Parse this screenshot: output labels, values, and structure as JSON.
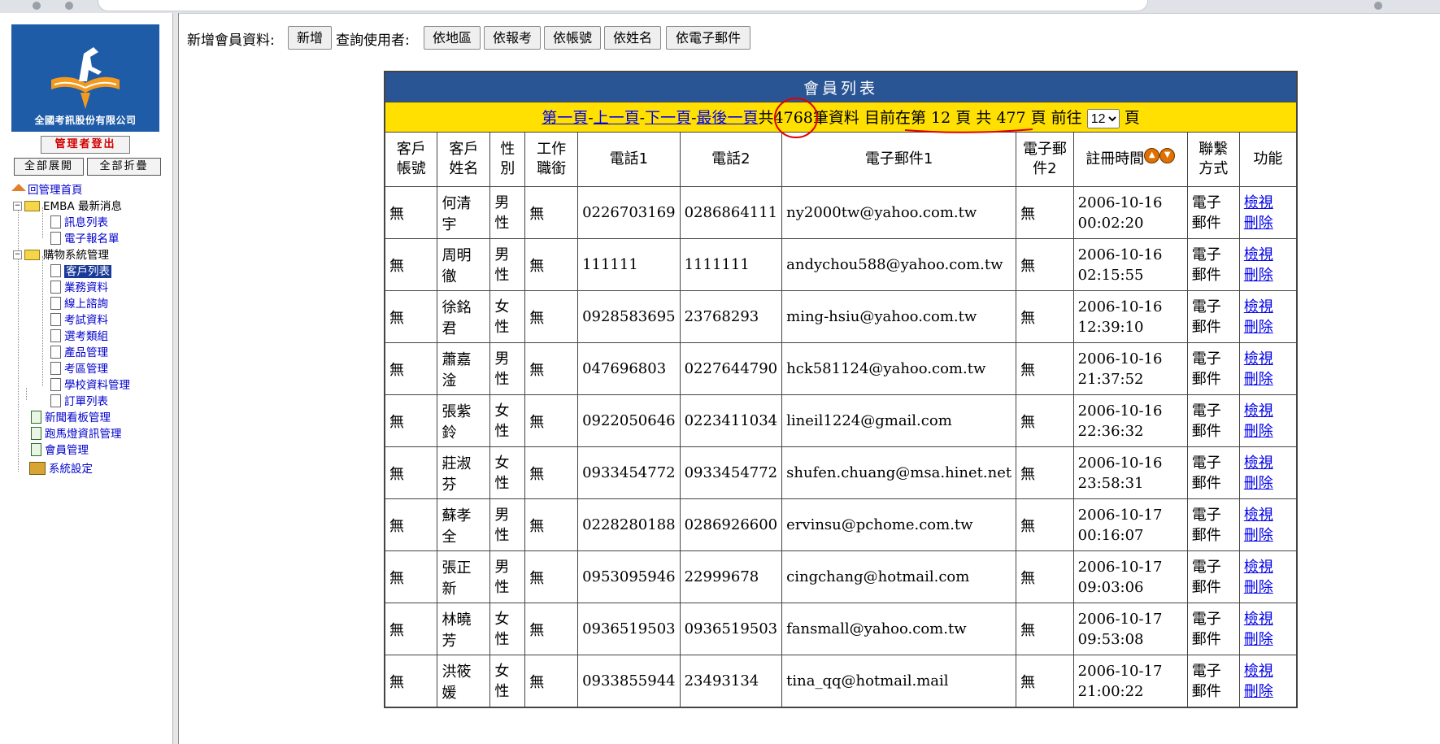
{
  "sidebar": {
    "logo_text": "全國考訊股份有限公司",
    "logout_label": "管理者登出",
    "expand_all_label": "全部展開",
    "collapse_all_label": "全部折疊",
    "tree": [
      {
        "label": "回管理首頁",
        "icon": "home-icon"
      },
      {
        "label": "EMBA 最新消息",
        "icon": "folder-icon"
      },
      {
        "label": "訊息列表",
        "icon": "document-icon"
      },
      {
        "label": "電子報名單",
        "icon": "document-icon"
      },
      {
        "label": "購物系統管理",
        "icon": "folder-icon"
      },
      {
        "label": "客戶列表",
        "icon": "document-icon",
        "selected": true
      },
      {
        "label": "業務資料",
        "icon": "document-icon"
      },
      {
        "label": "線上諮詢",
        "icon": "document-icon"
      },
      {
        "label": "考試資料",
        "icon": "document-icon"
      },
      {
        "label": "選考類組",
        "icon": "document-icon"
      },
      {
        "label": "產品管理",
        "icon": "document-icon"
      },
      {
        "label": "考區管理",
        "icon": "document-icon"
      },
      {
        "label": "學校資料管理",
        "icon": "document-icon"
      },
      {
        "label": "訂單列表",
        "icon": "document-icon"
      },
      {
        "label": "新聞看板管理",
        "icon": "document-icon"
      },
      {
        "label": "跑馬燈資訊管理",
        "icon": "document-icon"
      },
      {
        "label": "會員管理",
        "icon": "document-icon"
      },
      {
        "label": "系統設定",
        "icon": "settings-icon"
      }
    ]
  },
  "toolbar": {
    "add_label": "新增會員資料:",
    "add_button": "新增",
    "query_label": "查詢使用者:",
    "buttons": [
      "依地區",
      "依報考",
      "依帳號",
      "依姓名",
      "依電子郵件"
    ]
  },
  "table": {
    "title": "會員列表",
    "pager": {
      "first": "第一頁",
      "prev": "上一頁",
      "next": "下一頁",
      "last": "最後一頁",
      "sep": "-",
      "total_prefix": "共",
      "total_records": "4768",
      "total_suffix": "筆資料 目前在第",
      "current_page": "12",
      "page_of": "頁 共",
      "total_pages": "477",
      "goto_prefix": "頁 前往",
      "goto_value": "12",
      "goto_suffix": "頁"
    },
    "headers": [
      "客戶帳號",
      "客戶姓名",
      "性別",
      "工作職銜",
      "電話1",
      "電話2",
      "電子郵件1",
      "電子郵件2",
      "註冊時間",
      "聯繫方式",
      "功能"
    ],
    "view_label": "檢視",
    "delete_label": "刪除",
    "rows": [
      {
        "account": "無",
        "name": "何清宇",
        "gender": "男性",
        "title": "無",
        "phone1": "0226703169",
        "phone2": "0286864111",
        "email1": "ny2000tw@yahoo.com.tw",
        "email2": "無",
        "date": "2006-10-16",
        "time": "00:02:20",
        "contact": "電子郵件"
      },
      {
        "account": "無",
        "name": "周明徹",
        "gender": "男性",
        "title": "無",
        "phone1": "111111",
        "phone2": "1111111",
        "email1": "andychou588@yahoo.com.tw",
        "email2": "無",
        "date": "2006-10-16",
        "time": "02:15:55",
        "contact": "電子郵件"
      },
      {
        "account": "無",
        "name": "徐銘君",
        "gender": "女性",
        "title": "無",
        "phone1": "0928583695",
        "phone2": "23768293",
        "email1": "ming-hsiu@yahoo.com.tw",
        "email2": "無",
        "date": "2006-10-16",
        "time": "12:39:10",
        "contact": "電子郵件"
      },
      {
        "account": "無",
        "name": "蕭嘉淦",
        "gender": "男性",
        "title": "無",
        "phone1": "047696803",
        "phone2": "0227644790",
        "email1": "hck581124@yahoo.com.tw",
        "email2": "無",
        "date": "2006-10-16",
        "time": "21:37:52",
        "contact": "電子郵件"
      },
      {
        "account": "無",
        "name": "張紫鈴",
        "gender": "女性",
        "title": "無",
        "phone1": "0922050646",
        "phone2": "0223411034",
        "email1": "lineil1224@gmail.com",
        "email2": "無",
        "date": "2006-10-16",
        "time": "22:36:32",
        "contact": "電子郵件"
      },
      {
        "account": "無",
        "name": "莊淑芬",
        "gender": "女性",
        "title": "無",
        "phone1": "0933454772",
        "phone2": "0933454772",
        "email1": "shufen.chuang@msa.hinet.net",
        "email2": "無",
        "date": "2006-10-16",
        "time": "23:58:31",
        "contact": "電子郵件"
      },
      {
        "account": "無",
        "name": "蘇孝全",
        "gender": "男性",
        "title": "無",
        "phone1": "0228280188",
        "phone2": "0286926600",
        "email1": "ervinsu@pchome.com.tw",
        "email2": "無",
        "date": "2006-10-17",
        "time": "00:16:07",
        "contact": "電子郵件"
      },
      {
        "account": "無",
        "name": "張正新",
        "gender": "男性",
        "title": "無",
        "phone1": "0953095946",
        "phone2": "22999678",
        "email1": "cingchang@hotmail.com",
        "email2": "無",
        "date": "2006-10-17",
        "time": "09:03:06",
        "contact": "電子郵件"
      },
      {
        "account": "無",
        "name": "林曉芳",
        "gender": "女性",
        "title": "無",
        "phone1": "0936519503",
        "phone2": "0936519503",
        "email1": "fansmall@yahoo.com.tw",
        "email2": "無",
        "date": "2006-10-17",
        "time": "09:53:08",
        "contact": "電子郵件"
      },
      {
        "account": "無",
        "name": "洪筱媛",
        "gender": "女性",
        "title": "無",
        "phone1": "0933855944",
        "phone2": "23493134",
        "email1": "tina_qq@hotmail.mail",
        "email2": "無",
        "date": "2006-10-17",
        "time": "21:00:22",
        "contact": "電子郵件"
      }
    ]
  },
  "colors": {
    "title_bar": "#2a5595",
    "pager_bar": "#ffe000",
    "link": "#0000ee",
    "annotation": "#e00000"
  }
}
